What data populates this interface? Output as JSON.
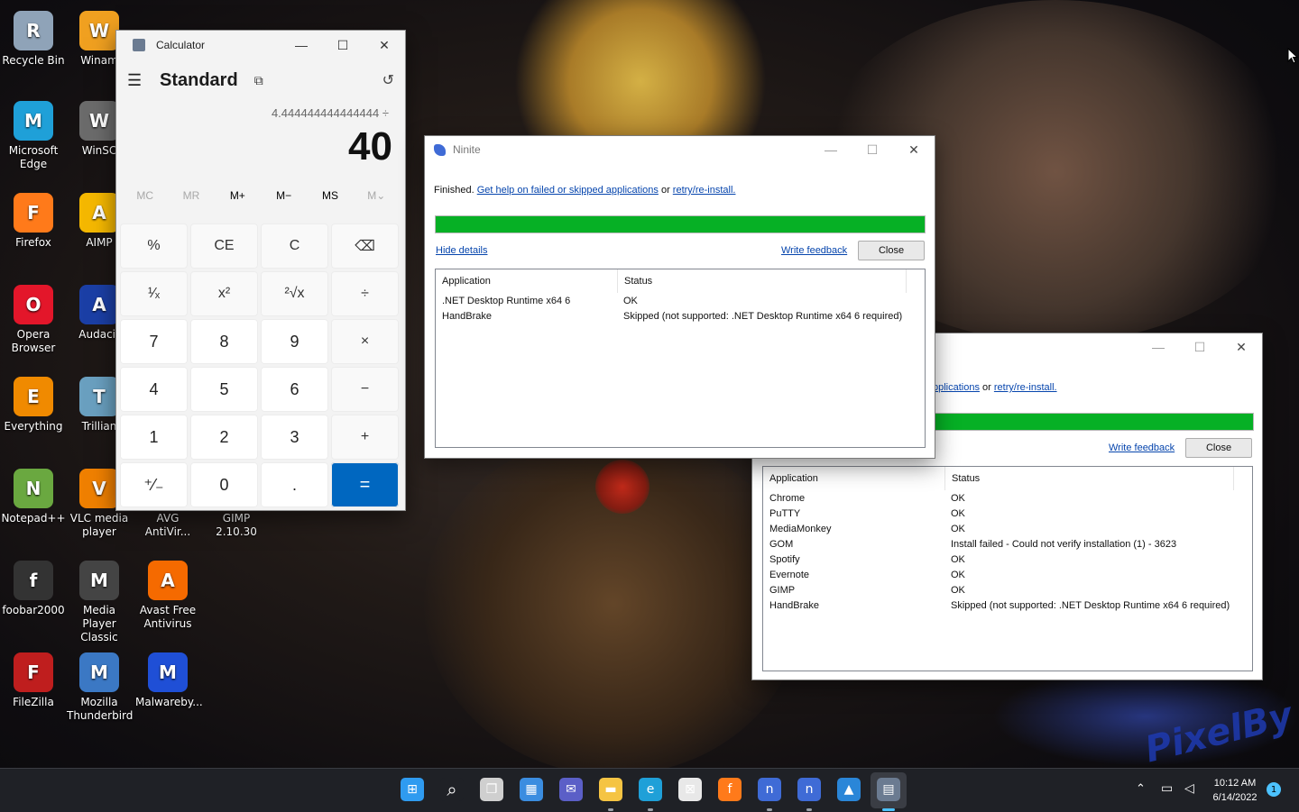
{
  "desktop": {
    "icons": [
      {
        "label": "Recycle Bin",
        "icon": "recycle-bin-icon",
        "color": "#8fa3b8"
      },
      {
        "label": "Winam",
        "icon": "winamp-icon",
        "color": "#f0a020"
      },
      {
        "label": "Microsoft Edge",
        "icon": "edge-icon",
        "color": "#1fa0d8"
      },
      {
        "label": "WinSC",
        "icon": "winscp-icon",
        "color": "#6b6b6b"
      },
      {
        "label": "Firefox",
        "icon": "firefox-icon",
        "color": "#ff7a1a"
      },
      {
        "label": "AIMP",
        "icon": "aimp-icon",
        "color": "#f5b800"
      },
      {
        "label": "Opera Browser",
        "icon": "opera-icon",
        "color": "#e3162a"
      },
      {
        "label": "Audacit",
        "icon": "audacity-icon",
        "color": "#1b3fa6"
      },
      {
        "label": "Everything",
        "icon": "everything-icon",
        "color": "#f08a00"
      },
      {
        "label": "Trillian",
        "icon": "trillian-icon",
        "color": "#6aa0c0"
      },
      {
        "label": "Notepad++",
        "icon": "notepadpp-icon",
        "color": "#6aa840"
      },
      {
        "label": "VLC media player",
        "icon": "vlc-icon",
        "color": "#f08000"
      },
      {
        "label": "AVG AntiVir...",
        "icon": "avg-icon",
        "color": "#2f6fb6"
      },
      {
        "label": "GIMP 2.10.30",
        "icon": "gimp-icon",
        "color": "#7a6a4a"
      },
      {
        "label": "foobar2000",
        "icon": "foobar-icon",
        "color": "#333333"
      },
      {
        "label": "Media Player Classic",
        "icon": "mpc-icon",
        "color": "#444444"
      },
      {
        "label": "Avast Free Antivirus",
        "icon": "avast-icon",
        "color": "#f56a00"
      },
      {
        "label": "FileZilla",
        "icon": "filezilla-icon",
        "color": "#bf1e1e"
      },
      {
        "label": "Mozilla Thunderbird",
        "icon": "thunderbird-icon",
        "color": "#3b78c4"
      },
      {
        "label": "Malwareby...",
        "icon": "malwarebytes-icon",
        "color": "#1f4fd6"
      }
    ],
    "watermark": "PixelBy"
  },
  "calculator": {
    "title": "Calculator",
    "mode": "Standard",
    "expression": "4.444444444444444 ÷",
    "result": "40",
    "memory": [
      "MC",
      "MR",
      "M+",
      "M−",
      "MS",
      "M⌄"
    ],
    "keys": [
      "%",
      "CE",
      "C",
      "⌫",
      "¹⁄ₓ",
      "x²",
      "²√x",
      "÷",
      "7",
      "8",
      "9",
      "×",
      "4",
      "5",
      "6",
      "−",
      "1",
      "2",
      "3",
      "+",
      "⁺⁄₋",
      "0",
      ".",
      "="
    ],
    "minimize": "—",
    "maximize": "☐",
    "close": "✕"
  },
  "ninite_front": {
    "title": "Ninite",
    "status_prefix": "Finished.",
    "help_link": "Get help on failed or skipped applications",
    "or_text": "or",
    "retry_link": "retry/re-install.",
    "hide_details": "Hide details",
    "write_feedback": "Write feedback",
    "close_label": "Close",
    "progress_percent": 100,
    "columns": [
      "Application",
      "Status"
    ],
    "rows": [
      {
        "app": ".NET Desktop Runtime x64 6",
        "status": "OK"
      },
      {
        "app": "HandBrake",
        "status": "Skipped (not supported: .NET Desktop Runtime x64 6 required)"
      }
    ]
  },
  "ninite_back": {
    "help_link_partial": "pplications",
    "or_text": "or",
    "retry_link": "retry/re-install.",
    "write_feedback": "Write feedback",
    "close_label": "Close",
    "progress_percent": 100,
    "columns": [
      "Application",
      "Status"
    ],
    "rows": [
      {
        "app": "Chrome",
        "status": "OK"
      },
      {
        "app": "PuTTY",
        "status": "OK"
      },
      {
        "app": "MediaMonkey",
        "status": "OK"
      },
      {
        "app": "GOM",
        "status": "Install failed - Could not verify installation (1) - 3623"
      },
      {
        "app": "Spotify",
        "status": "OK"
      },
      {
        "app": "Evernote",
        "status": "OK"
      },
      {
        "app": "GIMP",
        "status": "OK"
      },
      {
        "app": "HandBrake",
        "status": "Skipped (not supported: .NET Desktop Runtime x64 6 required)"
      }
    ]
  },
  "taskbar": {
    "items": [
      {
        "name": "start-icon",
        "color": "#2f9bf0"
      },
      {
        "name": "search-icon",
        "color": "#1f2126"
      },
      {
        "name": "task-view-icon",
        "color": "#cfcfcf"
      },
      {
        "name": "widgets-icon",
        "color": "#3b8de0"
      },
      {
        "name": "chat-icon",
        "color": "#5b5fc7"
      },
      {
        "name": "file-explorer-icon",
        "color": "#f5c443"
      },
      {
        "name": "edge-icon",
        "color": "#1fa0d8"
      },
      {
        "name": "store-icon",
        "color": "#e8e8e8"
      },
      {
        "name": "firefox-icon",
        "color": "#ff7a1a"
      },
      {
        "name": "ninite-icon",
        "color": "#3f6bd6"
      },
      {
        "name": "ninite-icon-2",
        "color": "#3f6bd6"
      },
      {
        "name": "photos-icon",
        "color": "#2a86d8"
      },
      {
        "name": "calculator-icon",
        "color": "#6b7b91"
      }
    ],
    "time": "10:12 AM",
    "date": "6/14/2022",
    "notifications": "1"
  }
}
